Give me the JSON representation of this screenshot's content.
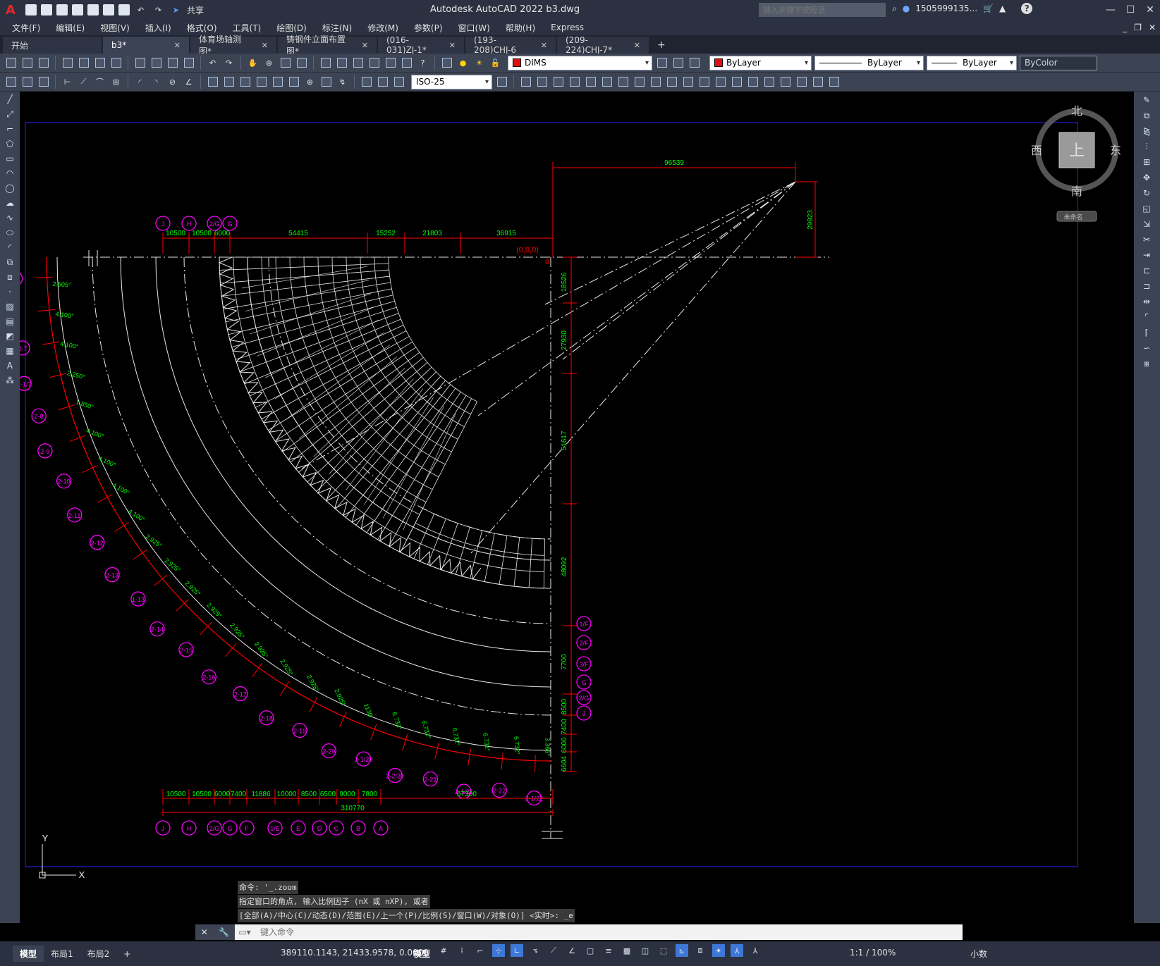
{
  "app": {
    "logo": "A",
    "title": "Autodesk AutoCAD 2022    b3.dwg",
    "share": "共享",
    "search_placeholder": "键入关键字或短语",
    "user": "1505999135...",
    "help": "?"
  },
  "menu": [
    "文件(F)",
    "编辑(E)",
    "视图(V)",
    "插入(I)",
    "格式(O)",
    "工具(T)",
    "绘图(D)",
    "标注(N)",
    "修改(M)",
    "参数(P)",
    "窗口(W)",
    "帮助(H)",
    "Express"
  ],
  "tabs": [
    {
      "label": "开始"
    },
    {
      "label": "b3*",
      "active": true
    },
    {
      "label": "体育场轴测图*"
    },
    {
      "label": "铸钢件立面布置图*"
    },
    {
      "label": "(016-031)ZJ-1*"
    },
    {
      "label": "(193-208)CHJ-6"
    },
    {
      "label": "(209-224)CHJ-7*"
    }
  ],
  "toolbar": {
    "layer": "DIMS",
    "color": "ByLayer",
    "linetype": "ByLayer",
    "lineweight": "ByLayer",
    "plotstyle": "ByColor",
    "dimstyle": "ISO-25"
  },
  "viewcube": {
    "north": "北",
    "south": "南",
    "east": "东",
    "west": "西",
    "top": "上",
    "wcs": "未命名"
  },
  "drawing": {
    "top_axes": [
      "J",
      "H",
      "2/G",
      "G"
    ],
    "top_dims": [
      "10500",
      "10500",
      "6000",
      "54415",
      "15252",
      "21803",
      "36915"
    ],
    "span_dim": "96539",
    "rise_dim": "29923",
    "origin": "(0,0,0)",
    "origin_zero": "0",
    "right_dims": [
      "18526",
      "27930",
      "51617",
      "48092",
      "7700",
      "8500",
      "7400",
      "6000",
      "6604"
    ],
    "right_axes": [
      "1/F",
      "2/F",
      "3/F",
      "G",
      "2/G",
      "J"
    ],
    "left_axes": [
      "2-5",
      "2-6",
      "2-7",
      "2-1/7",
      "2-8",
      "2-9",
      "2-10",
      "2-11",
      "2-12",
      "2-13",
      "1-13",
      "2-14",
      "2-15",
      "2-16",
      "2-17",
      "2-18",
      "2-19",
      "2-20",
      "2-1/20",
      "2-2/20",
      "2-21",
      "2-1/21",
      "2-22",
      "2-1/22"
    ],
    "angle_dims": [
      "2.605°",
      "4.100°",
      "4.100°",
      "2.250°",
      "1.850°",
      "4.100°",
      "4.100°",
      "4.100°",
      "4.100°",
      "2.925°",
      "2.925°",
      "2.925°",
      "2.925°",
      "2.925°",
      "2.925°",
      "2.925°",
      "2.925°",
      "2.925°",
      "1130",
      "6.732°",
      "6.732°",
      "6.732°",
      "6.732°",
      "6.732°",
      "3.366°"
    ],
    "bottom_dims": [
      "10500",
      "10500",
      "6000",
      "7400",
      "11886",
      "10000",
      "8500",
      "6500",
      "9000",
      "7800",
      "67300"
    ],
    "bottom_total": "310770",
    "bottom_axes": [
      "J",
      "H",
      "2/G",
      "G",
      "F",
      "1/E",
      "E",
      "D",
      "C",
      "B",
      "A"
    ],
    "ucs_y": "Y",
    "ucs_x": "X"
  },
  "command": {
    "history": [
      "命令: '_.zoom",
      "指定窗口的角点, 输入比例因子 (nX 或 nXP), 或者",
      "[全部(A)/中心(C)/动态(D)/范围(E)/上一个(P)/比例(S)/窗口(W)/对象(O)] <实时>: _e"
    ],
    "placeholder": "键入命令"
  },
  "status": {
    "layouts": [
      "模型",
      "布局1",
      "布局2"
    ],
    "coords": "389110.1143, 21433.9578, 0.0000",
    "model": "模型",
    "scale": "1:1 / 100%",
    "units": "小数"
  },
  "colors": {
    "dim": "#ff0000",
    "dimtext": "#00ff00",
    "axis": "#ff00ff",
    "struct": "#e8e8e8",
    "border": "#1a1aa8"
  }
}
